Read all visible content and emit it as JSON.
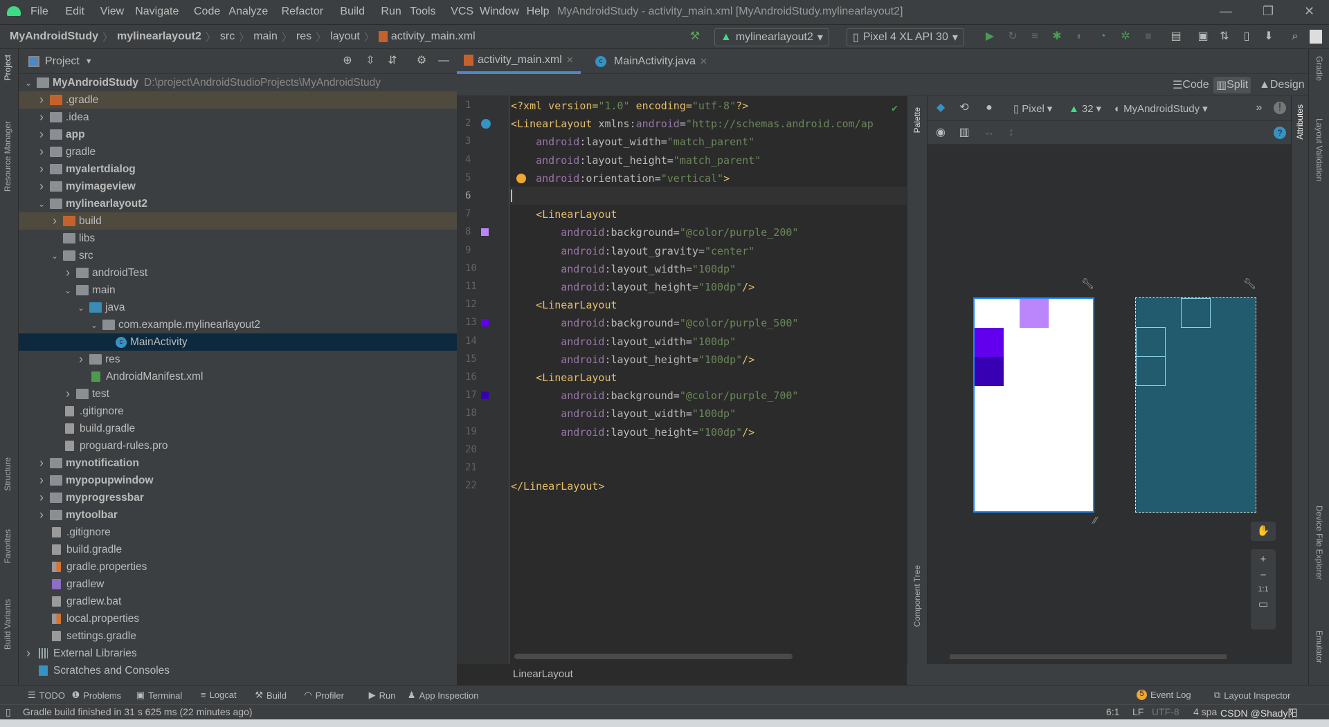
{
  "menu": [
    "File",
    "Edit",
    "View",
    "Navigate",
    "Code",
    "Analyze",
    "Refactor",
    "Build",
    "Run",
    "Tools",
    "VCS",
    "Window",
    "Help"
  ],
  "window_title": "MyAndroidStudy - activity_main.xml [MyAndroidStudy.mylinearlayout2]",
  "breadcrumb": [
    "MyAndroidStudy",
    "mylinearlayout2",
    "src",
    "main",
    "res",
    "layout",
    "activity_main.xml"
  ],
  "run_config": "mylinearlayout2",
  "device": "Pixel 4 XL API 30",
  "left_strip": [
    "Project",
    "Resource Manager",
    "Structure",
    "Favorites",
    "Build Variants"
  ],
  "project_panel": {
    "title": "Project"
  },
  "tree": [
    {
      "label": "MyAndroidStudy",
      "path": "D:\\project\\AndroidStudioProjects\\MyAndroidStudy",
      "level": 0,
      "arrow": "open",
      "icon": "module",
      "bold": true
    },
    {
      "label": ".gradle",
      "level": 1,
      "arrow": "closed",
      "icon": "folder-orange",
      "excluded": true
    },
    {
      "label": ".idea",
      "level": 1,
      "arrow": "closed",
      "icon": "folder"
    },
    {
      "label": "app",
      "level": 1,
      "arrow": "closed",
      "icon": "module",
      "bold": true
    },
    {
      "label": "gradle",
      "level": 1,
      "arrow": "closed",
      "icon": "folder"
    },
    {
      "label": "myalertdialog",
      "level": 1,
      "arrow": "closed",
      "icon": "module",
      "bold": true
    },
    {
      "label": "myimageview",
      "level": 1,
      "arrow": "closed",
      "icon": "module",
      "bold": true
    },
    {
      "label": "mylinearlayout2",
      "level": 1,
      "arrow": "open",
      "icon": "module",
      "bold": true
    },
    {
      "label": "build",
      "level": 2,
      "arrow": "closed",
      "icon": "folder-orange",
      "excluded": true
    },
    {
      "label": "libs",
      "level": 2,
      "arrow": "none",
      "icon": "folder"
    },
    {
      "label": "src",
      "level": 2,
      "arrow": "open",
      "icon": "folder"
    },
    {
      "label": "androidTest",
      "level": 3,
      "arrow": "closed",
      "icon": "folder"
    },
    {
      "label": "main",
      "level": 3,
      "arrow": "open",
      "icon": "folder"
    },
    {
      "label": "java",
      "level": 4,
      "arrow": "open",
      "icon": "folder-blue"
    },
    {
      "label": "com.example.mylinearlayout2",
      "level": 5,
      "arrow": "open",
      "icon": "package"
    },
    {
      "label": "MainActivity",
      "level": 6,
      "arrow": "none",
      "icon": "class",
      "selected": true
    },
    {
      "label": "res",
      "level": 4,
      "arrow": "closed",
      "icon": "folder-res"
    },
    {
      "label": "AndroidManifest.xml",
      "level": 4,
      "arrow": "none",
      "icon": "manifest"
    },
    {
      "label": "test",
      "level": 3,
      "arrow": "closed",
      "icon": "folder"
    },
    {
      "label": ".gitignore",
      "level": 2,
      "arrow": "none",
      "icon": "file"
    },
    {
      "label": "build.gradle",
      "level": 2,
      "arrow": "none",
      "icon": "gradle"
    },
    {
      "label": "proguard-rules.pro",
      "level": 2,
      "arrow": "none",
      "icon": "file"
    },
    {
      "label": "mynotification",
      "level": 1,
      "arrow": "closed",
      "icon": "module",
      "bold": true
    },
    {
      "label": "mypopupwindow",
      "level": 1,
      "arrow": "closed",
      "icon": "module",
      "bold": true
    },
    {
      "label": "myprogressbar",
      "level": 1,
      "arrow": "closed",
      "icon": "module",
      "bold": true
    },
    {
      "label": "mytoolbar",
      "level": 1,
      "arrow": "closed",
      "icon": "module",
      "bold": true
    },
    {
      "label": ".gitignore",
      "level": 1,
      "arrow": "none",
      "icon": "file"
    },
    {
      "label": "build.gradle",
      "level": 1,
      "arrow": "none",
      "icon": "gradle"
    },
    {
      "label": "gradle.properties",
      "level": 1,
      "arrow": "none",
      "icon": "properties"
    },
    {
      "label": "gradlew",
      "level": 1,
      "arrow": "none",
      "icon": "shell"
    },
    {
      "label": "gradlew.bat",
      "level": 1,
      "arrow": "none",
      "icon": "file"
    },
    {
      "label": "local.properties",
      "level": 1,
      "arrow": "none",
      "icon": "properties"
    },
    {
      "label": "settings.gradle",
      "level": 1,
      "arrow": "none",
      "icon": "gradle"
    },
    {
      "label": "External Libraries",
      "level": 0,
      "arrow": "closed",
      "icon": "libraries"
    },
    {
      "label": "Scratches and Consoles",
      "level": 0,
      "arrow": "none",
      "icon": "scratches"
    }
  ],
  "tabs": [
    {
      "label": "activity_main.xml",
      "active": true
    },
    {
      "label": "MainActivity.java",
      "active": false
    }
  ],
  "modes": [
    "Code",
    "Split",
    "Design"
  ],
  "active_mode": "Split",
  "code": [
    [
      [
        "tag",
        "<?xml version="
      ],
      [
        "val",
        "\"1.0\""
      ],
      [
        "tag",
        " encoding="
      ],
      [
        "val",
        "\"utf-8\""
      ],
      [
        "tag",
        "?>"
      ]
    ],
    [
      [
        "tag",
        "<LinearLayout "
      ],
      [
        "attr",
        "xmlns:"
      ],
      [
        "ns",
        "android"
      ],
      [
        "attr",
        "="
      ],
      [
        "val",
        "\"http://schemas.android.com/ap"
      ]
    ],
    [
      [
        "pad",
        "    "
      ],
      [
        "ns",
        "android"
      ],
      [
        "attr",
        ":layout_width="
      ],
      [
        "val",
        "\"match_parent\""
      ]
    ],
    [
      [
        "pad",
        "    "
      ],
      [
        "ns",
        "android"
      ],
      [
        "attr",
        ":layout_height="
      ],
      [
        "val",
        "\"match_parent\""
      ]
    ],
    [
      [
        "pad",
        "    "
      ],
      [
        "ns",
        "android"
      ],
      [
        "attr",
        ":orientation="
      ],
      [
        "val",
        "\"vertical\""
      ],
      [
        "tag",
        ">"
      ]
    ],
    [],
    [
      [
        "pad",
        "    "
      ],
      [
        "tag",
        "<LinearLayout"
      ]
    ],
    [
      [
        "pad",
        "        "
      ],
      [
        "ns",
        "android"
      ],
      [
        "attr",
        ":background="
      ],
      [
        "val",
        "\"@color/purple_200\""
      ]
    ],
    [
      [
        "pad",
        "        "
      ],
      [
        "ns",
        "android"
      ],
      [
        "attr",
        ":layout_gravity="
      ],
      [
        "val",
        "\"center\""
      ]
    ],
    [
      [
        "pad",
        "        "
      ],
      [
        "ns",
        "android"
      ],
      [
        "attr",
        ":layout_width="
      ],
      [
        "val",
        "\"100dp\""
      ]
    ],
    [
      [
        "pad",
        "        "
      ],
      [
        "ns",
        "android"
      ],
      [
        "attr",
        ":layout_height="
      ],
      [
        "val",
        "\"100dp\""
      ],
      [
        "tag",
        "/>"
      ]
    ],
    [
      [
        "pad",
        "    "
      ],
      [
        "tag",
        "<LinearLayout"
      ]
    ],
    [
      [
        "pad",
        "        "
      ],
      [
        "ns",
        "android"
      ],
      [
        "attr",
        ":background="
      ],
      [
        "val",
        "\"@color/purple_500\""
      ]
    ],
    [
      [
        "pad",
        "        "
      ],
      [
        "ns",
        "android"
      ],
      [
        "attr",
        ":layout_width="
      ],
      [
        "val",
        "\"100dp\""
      ]
    ],
    [
      [
        "pad",
        "        "
      ],
      [
        "ns",
        "android"
      ],
      [
        "attr",
        ":layout_height="
      ],
      [
        "val",
        "\"100dp\""
      ],
      [
        "tag",
        "/>"
      ]
    ],
    [
      [
        "pad",
        "    "
      ],
      [
        "tag",
        "<LinearLayout"
      ]
    ],
    [
      [
        "pad",
        "        "
      ],
      [
        "ns",
        "android"
      ],
      [
        "attr",
        ":background="
      ],
      [
        "val",
        "\"@color/purple_700\""
      ]
    ],
    [
      [
        "pad",
        "        "
      ],
      [
        "ns",
        "android"
      ],
      [
        "attr",
        ":layout_width="
      ],
      [
        "val",
        "\"100dp\""
      ]
    ],
    [
      [
        "pad",
        "        "
      ],
      [
        "ns",
        "android"
      ],
      [
        "attr",
        ":layout_height="
      ],
      [
        "val",
        "\"100dp\""
      ],
      [
        "tag",
        "/>"
      ]
    ],
    [],
    [],
    [
      [
        "tag",
        "</LinearLayout>"
      ]
    ]
  ],
  "colors": {
    "purple_200": "#bb86fc",
    "purple_500": "#6200ee",
    "purple_700": "#3700b3",
    "accent": "#4a88c7"
  },
  "design_toolbar": {
    "device": "Pixel",
    "api": "32",
    "theme": "MyAndroidStudy"
  },
  "palette_label": "Palette",
  "component_tree_label": "Component Tree",
  "attributes_label": "Attributes",
  "right_strip": [
    "Gradle",
    "Layout Validation",
    "Device File Explorer",
    "Emulator"
  ],
  "zoom_controls": [
    "+",
    "−",
    "1:1"
  ],
  "editor_breadcrumb": "LinearLayout",
  "bottom_tools": [
    "TODO",
    "Problems",
    "Terminal",
    "Logcat",
    "Build",
    "Profiler",
    "Run",
    "App Inspection"
  ],
  "bottom_right_tools": [
    {
      "label": "Event Log",
      "badge": "5"
    },
    {
      "label": "Layout Inspector"
    }
  ],
  "status": {
    "message": "Gradle build finished in 31 s 625 ms (22 minutes ago)",
    "position": "6:1",
    "line_sep": "LF",
    "encoding": "UTF-8",
    "indent": "4 spa",
    "watermark": "CSDN @Shady阳"
  }
}
